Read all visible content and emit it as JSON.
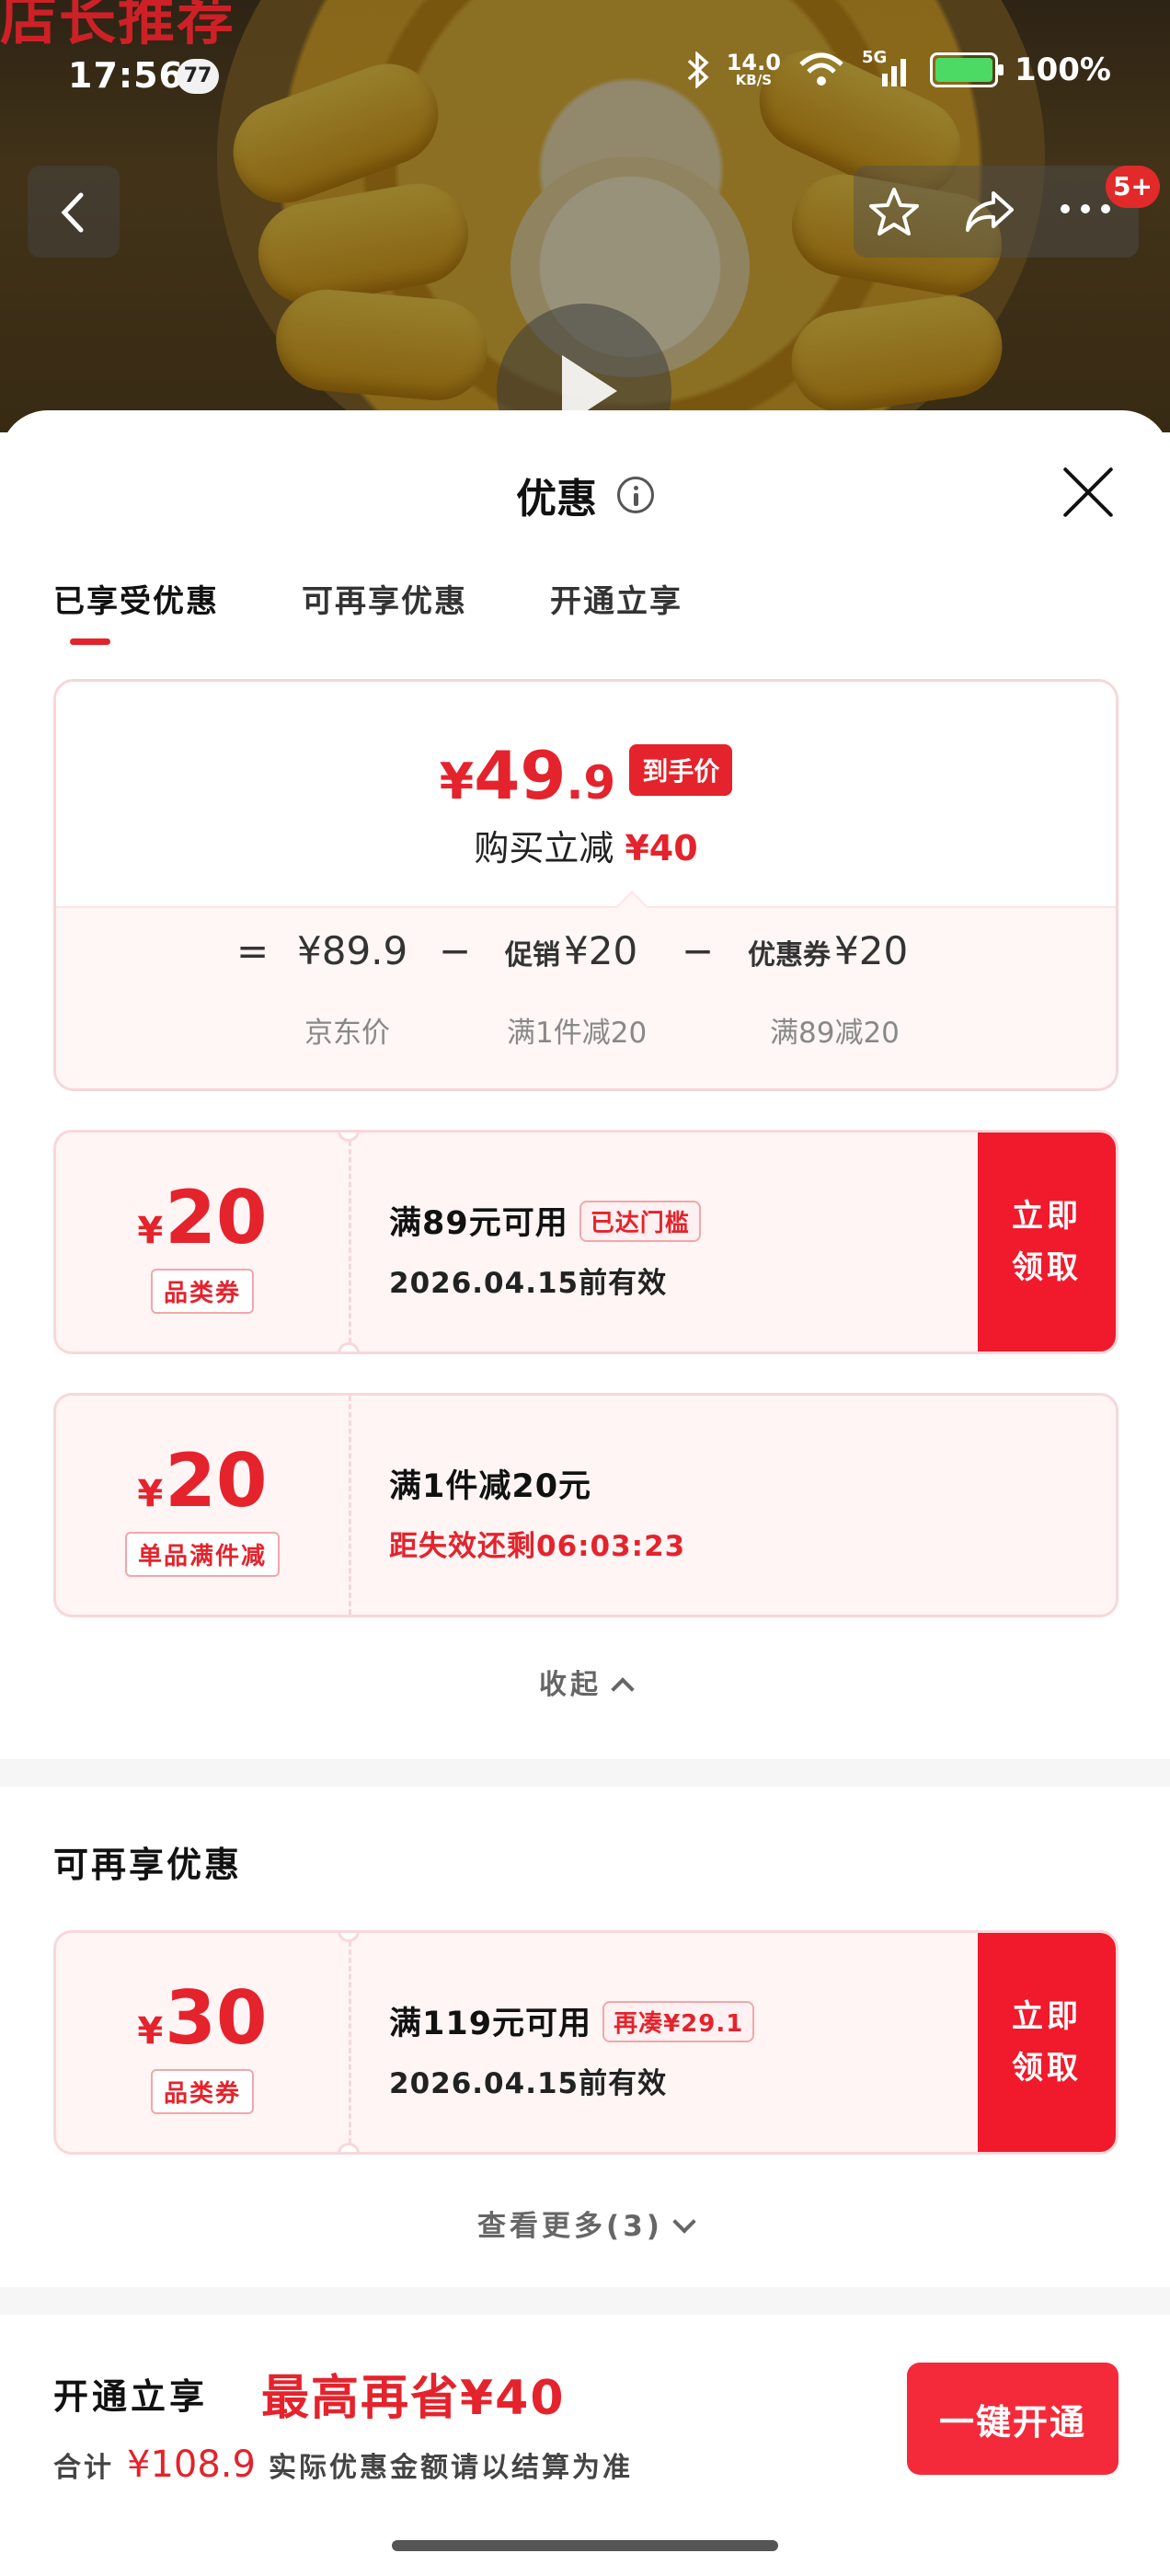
{
  "status_bar": {
    "time": "17:56",
    "notification_count": "77",
    "net_speed": "14.0",
    "net_unit": "KB/S",
    "signal_label": "5G",
    "battery": "100%"
  },
  "nav": {
    "badge": "5+",
    "bg_logo_text": "店长推荐"
  },
  "sheet": {
    "title": "优惠",
    "tabs": [
      {
        "label": "已享受优惠",
        "active": true
      },
      {
        "label": "可再享优惠",
        "active": false
      },
      {
        "label": "开通立享",
        "active": false
      }
    ]
  },
  "summary": {
    "price_yen": "¥",
    "price_int": "49",
    "price_dec": ".9",
    "price_tag": "到手价",
    "save_label": "购买立减",
    "save_amount": "¥40",
    "formula": {
      "equals": "=",
      "base_price": "¥89.9",
      "base_label": "京东价",
      "minus1": "−",
      "promo_prefix": "促销",
      "promo_amount": "¥20",
      "promo_label": "满1件减20",
      "minus2": "−",
      "coupon_prefix": "优惠券",
      "coupon_amount": "¥20",
      "coupon_label": "满89减20"
    }
  },
  "coupons_enjoyed": [
    {
      "yen": "¥",
      "amount": "20",
      "type": "品类券",
      "condition": "满89元可用",
      "chip": "已达门槛",
      "validity": "2026.04.15前有效",
      "button": "立即领取"
    },
    {
      "yen": "¥",
      "amount": "20",
      "type": "单品满件减",
      "condition": "满1件减20元",
      "validity": "距失效还剩06:03:23"
    }
  ],
  "collapse_label": "收起",
  "section2": {
    "title": "可再享优惠",
    "coupon": {
      "yen": "¥",
      "amount": "30",
      "type": "品类券",
      "condition": "满119元可用",
      "chip": "再凑¥29.1",
      "validity": "2026.04.15前有效",
      "button": "立即领取"
    },
    "more_label": "查看更多(3)"
  },
  "footer": {
    "title": "开通立享",
    "highlight": "最高再省¥40",
    "total_label": "合计",
    "total_amount": "¥108.9",
    "note": "实际优惠金额请以结算为准",
    "button": "一键开通"
  },
  "colors": {
    "accent_red": "#e4232c",
    "button_red": "#f01a2c",
    "card_bg": "#fff5f5"
  }
}
